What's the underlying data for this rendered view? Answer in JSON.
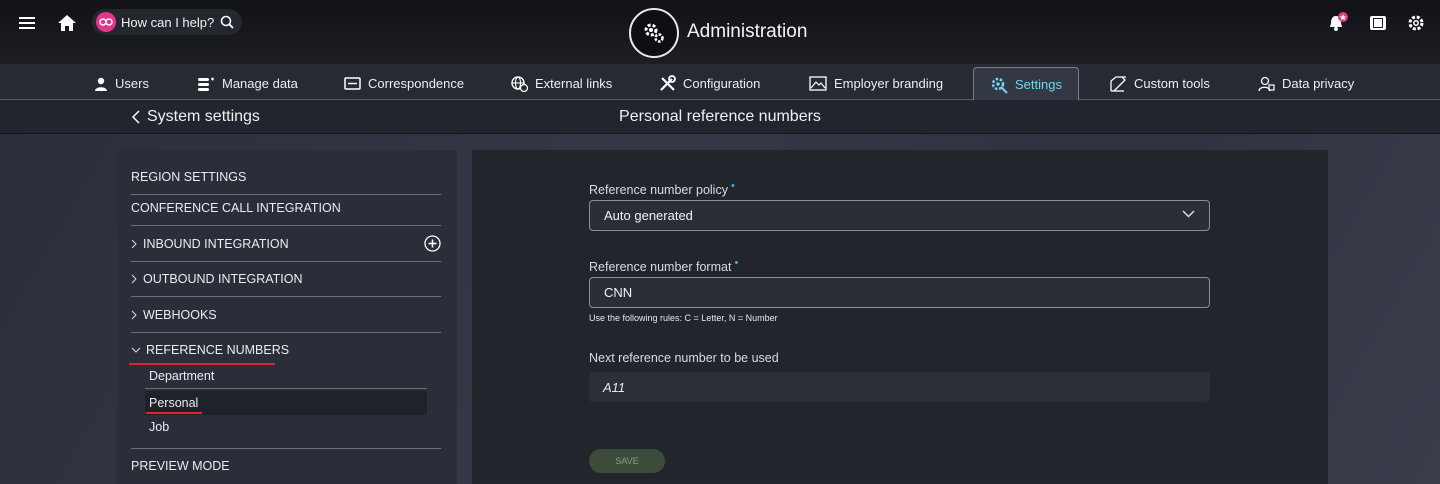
{
  "topbar": {
    "help_text": "How can I help?",
    "title": "Administration",
    "icons": [
      "menu-icon",
      "home-icon",
      "search-icon",
      "settings-gear-icon",
      "notification-bell-icon",
      "book-icon",
      "gear-icon"
    ]
  },
  "nav": {
    "items": [
      {
        "label": "Users",
        "icon": "user-icon"
      },
      {
        "label": "Manage data",
        "icon": "database-icon"
      },
      {
        "label": "Correspondence",
        "icon": "message-icon"
      },
      {
        "label": "External links",
        "icon": "globe-icon"
      },
      {
        "label": "Configuration",
        "icon": "tools-icon"
      },
      {
        "label": "Employer branding",
        "icon": "image-icon"
      },
      {
        "label": "Settings",
        "icon": "gear-icon",
        "active": true
      },
      {
        "label": "Custom tools",
        "icon": "edit-icon"
      },
      {
        "label": "Data privacy",
        "icon": "privacy-icon"
      }
    ]
  },
  "subbar": {
    "back_label": "System settings",
    "page_title": "Personal reference numbers"
  },
  "sidebar": {
    "items": [
      {
        "label": "REGION SETTINGS"
      },
      {
        "label": "CONFERENCE CALL INTEGRATION"
      },
      {
        "label": "INBOUND INTEGRATION"
      },
      {
        "label": "OUTBOUND INTEGRATION"
      },
      {
        "label": "WEBHOOKS"
      },
      {
        "label": "REFERENCE NUMBERS"
      },
      {
        "label": "PREVIEW MODE"
      }
    ],
    "sub_items": [
      {
        "label": "Department"
      },
      {
        "label": "Personal",
        "selected": true
      },
      {
        "label": "Job"
      }
    ]
  },
  "form": {
    "policy_label": "Reference number policy",
    "policy_value": "Auto generated",
    "format_label": "Reference number format",
    "format_value": "CNN",
    "format_hint": "Use the following rules: C = Letter, N = Number",
    "next_label": "Next reference number to be used",
    "next_value": "A11",
    "required_mark": "•",
    "save_label": "SAVE"
  },
  "colors": {
    "accent": "#6fd6f0",
    "required": "#32b6e8",
    "highlight_red": "#e2232a",
    "brand_pink": "#e8338c"
  }
}
